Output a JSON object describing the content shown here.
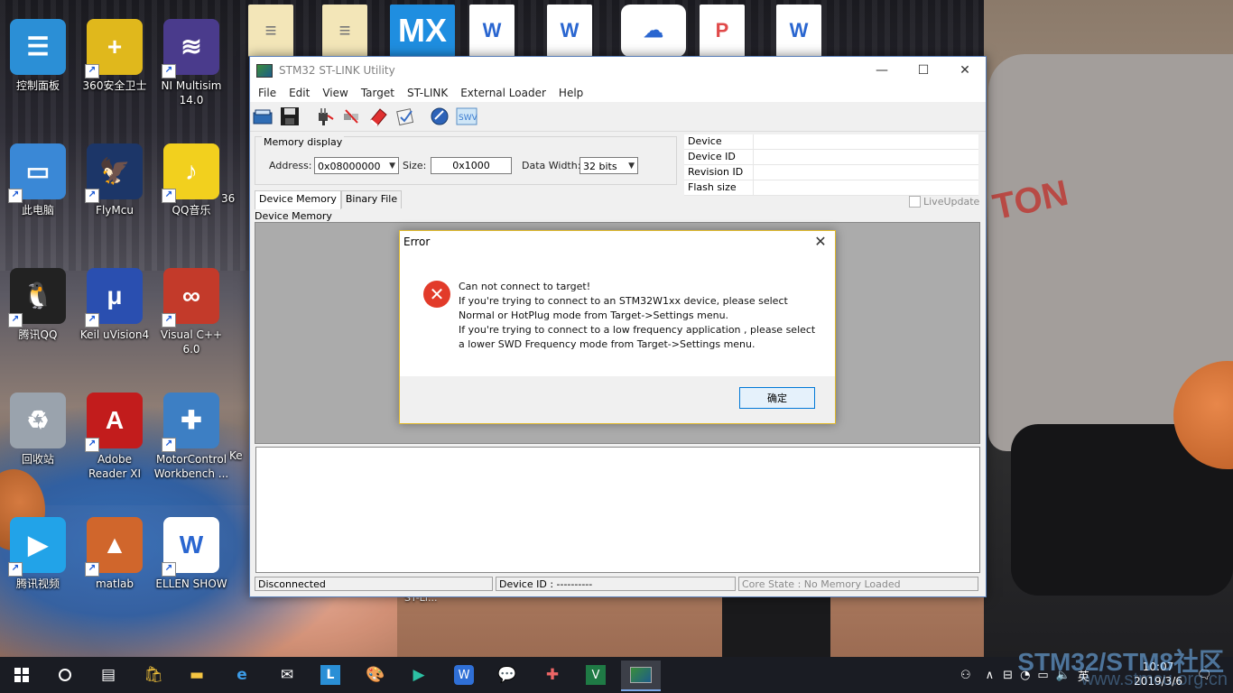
{
  "desktop": {
    "icons": [
      {
        "label": "控制面板",
        "glyph": "☰",
        "bg": "#2b8fd6"
      },
      {
        "label": "360安全卫士",
        "glyph": "+",
        "bg": "#e0b81c"
      },
      {
        "label": "NI Multisim\n14.0",
        "glyph": "≋",
        "bg": "#4a3b8c"
      },
      {
        "label": "此电脑",
        "glyph": "▭",
        "bg": "#3a88d6"
      },
      {
        "label": "FlyMcu",
        "glyph": "🦅",
        "bg": "#1c3668"
      },
      {
        "label": "QQ音乐",
        "glyph": "♪",
        "bg": "#f2d01e"
      },
      {
        "label": "腾讯QQ",
        "glyph": "🐧",
        "bg": "#222222"
      },
      {
        "label": "Keil uVision4",
        "glyph": "μ",
        "bg": "#2a4fb0"
      },
      {
        "label": "Visual C++\n6.0",
        "glyph": "∞",
        "bg": "#c33a2a"
      },
      {
        "label": "回收站",
        "glyph": "♻",
        "bg": "#9aa3ad"
      },
      {
        "label": "Adobe\nReader XI",
        "glyph": "A",
        "bg": "#c21c1c"
      },
      {
        "label": "MotorControl\nWorkbench ...",
        "glyph": "✚",
        "bg": "#3d7fc4"
      },
      {
        "label": "腾讯视频",
        "glyph": "▶",
        "bg": "#22a3e8"
      },
      {
        "label": "matlab",
        "glyph": "▲",
        "bg": "#d0662c"
      },
      {
        "label": "ELLEN SHOW",
        "glyph": "W",
        "bg": "#ffffff"
      }
    ],
    "partial_labels": [
      "36",
      "Ke"
    ],
    "top_row": [
      {
        "glyph": "≡",
        "bg": "#f3e6b8"
      },
      {
        "glyph": "≡",
        "bg": "#f3e6b8"
      },
      {
        "glyph": "MX",
        "bg": "#1f8ee0"
      },
      {
        "glyph": "W",
        "bg": "#ffffff"
      },
      {
        "glyph": "W",
        "bg": "#ffffff"
      },
      {
        "glyph": "☁",
        "bg": "#ffffff"
      },
      {
        "glyph": "P",
        "bg": "#ffffff"
      },
      {
        "glyph": "W",
        "bg": "#ffffff"
      }
    ],
    "behind_window_label": "ST-LI...",
    "watermark": "STM32/STM8社区",
    "watermark_url": "www.stmcu.org.cn"
  },
  "window": {
    "title": "STM32 ST-LINK Utility",
    "controls": {
      "minimize": "—",
      "maximize": "☐",
      "close": "✕"
    },
    "menu": [
      "File",
      "Edit",
      "View",
      "Target",
      "ST-LINK",
      "External Loader",
      "Help"
    ],
    "toolbar_icons": [
      "open-icon",
      "save-icon",
      "connect-icon",
      "disconnect-icon",
      "erase-icon",
      "program-icon",
      "update-icon",
      "swv-icon"
    ],
    "memory_display": {
      "legend": "Memory display",
      "address_label": "Address:",
      "address_value": "0x08000000",
      "size_label": "Size:",
      "size_value": "0x1000",
      "width_label": "Data Width:",
      "width_value": "32 bits"
    },
    "device_info": [
      {
        "key": "Device",
        "value": ""
      },
      {
        "key": "Device ID",
        "value": ""
      },
      {
        "key": "Revision ID",
        "value": ""
      },
      {
        "key": "Flash size",
        "value": ""
      }
    ],
    "tabs": [
      "Device Memory",
      "Binary File"
    ],
    "live_update": "LiveUpdate",
    "memory_label": "Device Memory",
    "status": {
      "connection": "Disconnected",
      "device_id": "Device ID : ----------",
      "core_state": "Core State : No Memory Loaded"
    }
  },
  "dialog": {
    "title": "Error",
    "close": "✕",
    "message": "Can not connect to target!\nIf you're trying to connect to an STM32W1xx device, please select\nNormal or HotPlug mode from Target->Settings menu.\nIf you're trying to connect to a low frequency application , please select\na lower SWD Frequency mode from Target->Settings menu.",
    "ok_label": "确定"
  },
  "taskbar": {
    "apps": [
      "start",
      "cortana",
      "task-view",
      "store",
      "explorer",
      "edge",
      "mail",
      "L-app",
      "paint",
      "tencent-video",
      "wps",
      "wechat",
      "motor",
      "excel",
      "stlink"
    ],
    "tray": {
      "ime": "英",
      "time": "10:07",
      "date": "2019/3/6"
    }
  }
}
